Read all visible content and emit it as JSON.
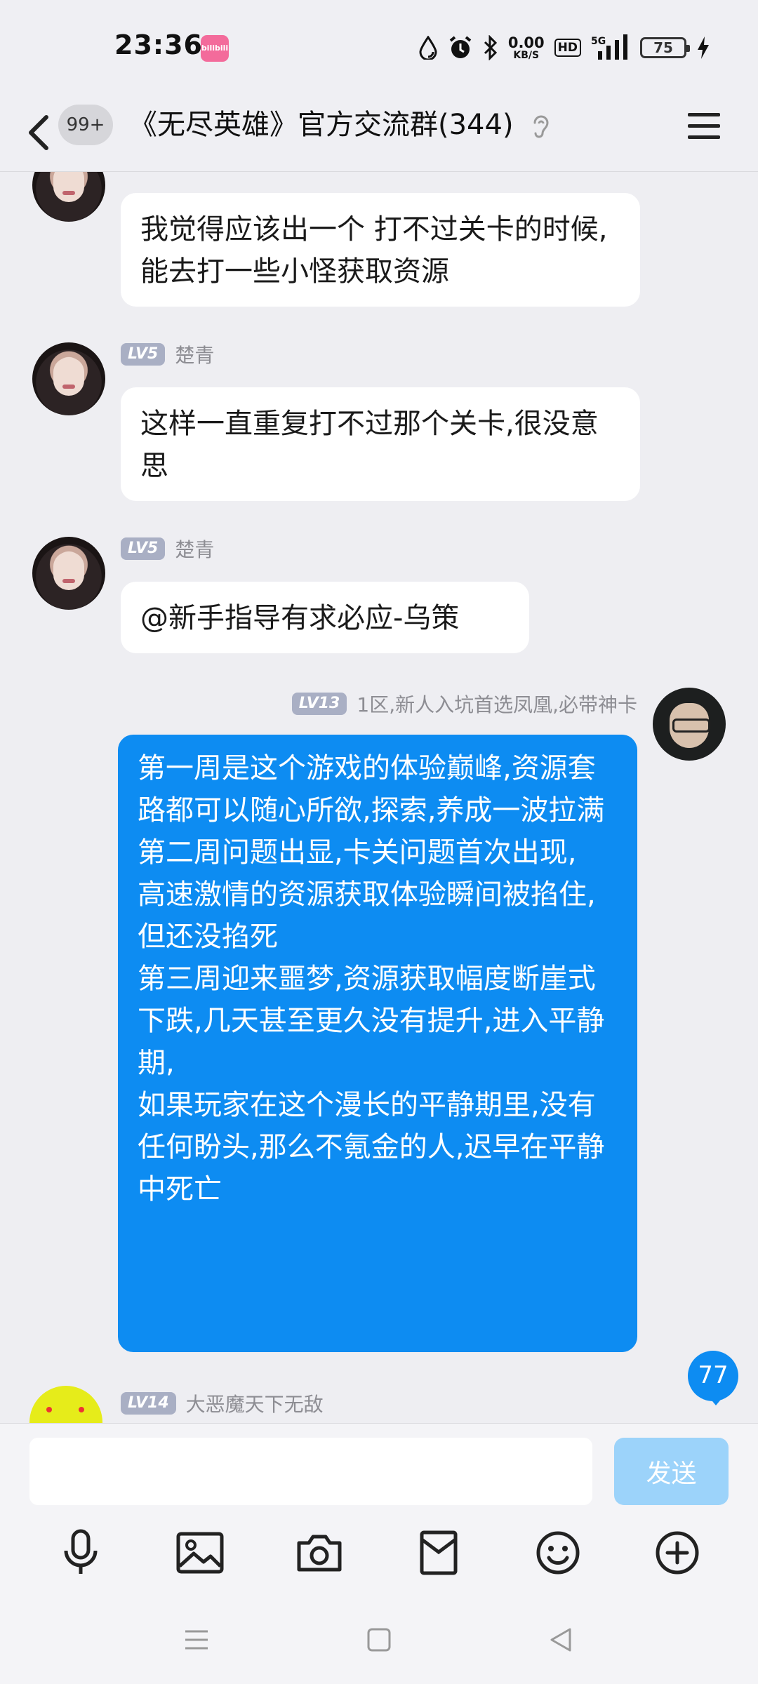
{
  "status_bar": {
    "time": "23:36",
    "app_icon_label": "bilibili",
    "net_speed_value": "0.00",
    "net_speed_unit": "KB/S",
    "hd_label": "HD",
    "signal_label": "5G",
    "battery": "75"
  },
  "header": {
    "unread_count": "99+",
    "title": "《无尽英雄》官方交流群(344)"
  },
  "messages": [
    {
      "sender_level": "",
      "sender_name": "",
      "text": "我觉得应该出一个 打不过关卡的时候,能去打一些小怪获取资源"
    },
    {
      "sender_level": "LV5",
      "sender_name": "楚青",
      "text": "这样一直重复打不过那个关卡,很没意思"
    },
    {
      "sender_level": "LV5",
      "sender_name": "楚青",
      "text": "@新手指导有求必应-乌策"
    },
    {
      "sender_level": "LV13",
      "sender_name": "1区,新人入坑首选凤凰,必带神卡",
      "text": "第一周是这个游戏的体验巅峰,资源套路都可以随心所欲,探索,养成一波拉满\n第二周问题出显,卡关问题首次出现,\n高速激情的资源获取体验瞬间被掐住,但还没掐死\n第三周迎来噩梦,资源获取幅度断崖式下跌,几天甚至更久没有提升,进入平静期,\n如果玩家在这个漫长的平静期里,没有任何盼头,那么不氪金的人,迟早在平静中死亡"
    },
    {
      "sender_level": "LV14",
      "sender_name": "大恶魔天下无敌",
      "text": ""
    }
  ],
  "new_message_count": "77",
  "composer": {
    "placeholder": "",
    "send_label": "发送"
  },
  "toolbar_icons": [
    "microphone-icon",
    "image-icon",
    "camera-icon",
    "red-packet-icon",
    "emoji-icon",
    "plus-icon"
  ],
  "nav_icons": [
    "menu-icon",
    "home-icon",
    "back-icon"
  ],
  "colors": {
    "accent": "#0d8cf2",
    "send_disabled": "#9cd3fa",
    "background": "#eeeef2",
    "level_badge": "#a9afc4"
  }
}
